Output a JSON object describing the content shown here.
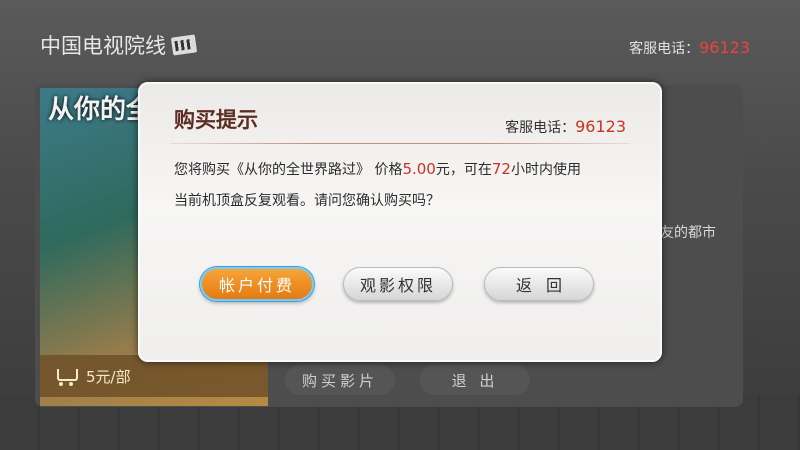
{
  "app": {
    "title": "中国电视院线",
    "hotline_label": "客服电话：",
    "hotline_number": "96123"
  },
  "background": {
    "poster_title": "从你的全世路过",
    "price": "5元/部",
    "side_text": "友的都市",
    "buttons": {
      "buy": "购买影片",
      "exit": "退 出"
    }
  },
  "dialog": {
    "title": "购买提示",
    "hotline_label": "客服电话：",
    "hotline_number": "96123",
    "message": {
      "part1": "您将购买《从你的全世界路过》 价格",
      "price": "5.00",
      "part2": "元，可在",
      "hours": "72",
      "part3": "小时内使用",
      "line2": "当前机顶盒反复观看。请问您确认购买吗？"
    },
    "buttons": {
      "pay": "帐户付费",
      "limit": "观影权限",
      "back": "返回"
    }
  },
  "colors": {
    "accent_orange": "#e47b12",
    "highlight_red": "#c9331f",
    "focus_blue": "#3aa0e0"
  }
}
